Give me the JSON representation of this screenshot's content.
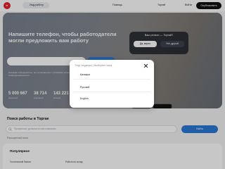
{
  "nav": {
    "logo": "tr",
    "jobs_tab": "Ищу работу",
    "help": "Помощь",
    "language": "Торгай",
    "login": "Войти",
    "post_button": "Опубликовать вакансию"
  },
  "hero": {
    "title": "Напишите телефон, чтобы работодатели могли предложить вам работу",
    "note": "Нажимая «Продолжить», вы соглашаетесь с условиями использования и политикой конфиденциальности",
    "stats": [
      {
        "value": "5 000 667",
        "label": "вакансий"
      },
      {
        "value": "38 714",
        "label": "компаний"
      },
      {
        "value": "143 221",
        "label": "резюме"
      }
    ],
    "region_question": "Ваш регион — Торгай?",
    "region_yes": "Да, верно",
    "region_no": "Нет, другой"
  },
  "search": {
    "title": "Поиск работы в Торгае",
    "placeholder": "Профессия, должность или компания",
    "find_button": "Найти",
    "link": "Расширенный поиск"
  },
  "popular": {
    "title": "Популярное",
    "items": [
      "Гостиничный бизнес",
      "Работа на склад"
    ]
  },
  "modal": {
    "title": "Тілді таңдаңыз | Выберите язык",
    "options": [
      "Қазақша",
      "Русский",
      "English"
    ]
  }
}
